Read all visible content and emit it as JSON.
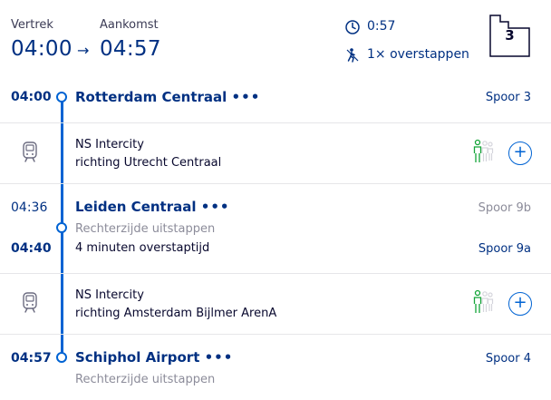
{
  "header": {
    "departure_label": "Vertrek",
    "arrival_label": "Aankomst",
    "departure_time": "04:00",
    "arrival_time": "04:57",
    "arrow": "→",
    "duration": "0:57",
    "transfers": "1× overstappen",
    "platform_badge": "3"
  },
  "stops": [
    {
      "time": "04:00",
      "station": "Rotterdam Centraal",
      "dots": "•••",
      "platform": "Spoor 3"
    },
    {
      "time": "04:36",
      "station": "Leiden Centraal",
      "dots": "•••",
      "platform": "Spoor 9b",
      "note": "Rechterzijde uitstappen",
      "time2": "04:40",
      "transfer": "4 minuten overstaptijd",
      "platform2": "Spoor 9a"
    },
    {
      "time": "04:57",
      "station": "Schiphol Airport",
      "dots": "•••",
      "platform": "Spoor 4",
      "note": "Rechterzijde uitstappen"
    }
  ],
  "legs": [
    {
      "train": "NS Intercity",
      "direction": "richting Utrecht Centraal",
      "add": "+"
    },
    {
      "train": "NS Intercity",
      "direction": "richting Amsterdam Bijlmer ArenA",
      "add": "+"
    }
  ],
  "icons": {
    "clock": "clock-icon",
    "transfer": "transfer-icon",
    "train": "train-icon",
    "occupancy": "people-occupancy-icon",
    "platform": "platform-icon"
  },
  "colors": {
    "brand_blue": "#003082",
    "line_blue": "#0063d3",
    "occupancy_green": "#13a538"
  }
}
